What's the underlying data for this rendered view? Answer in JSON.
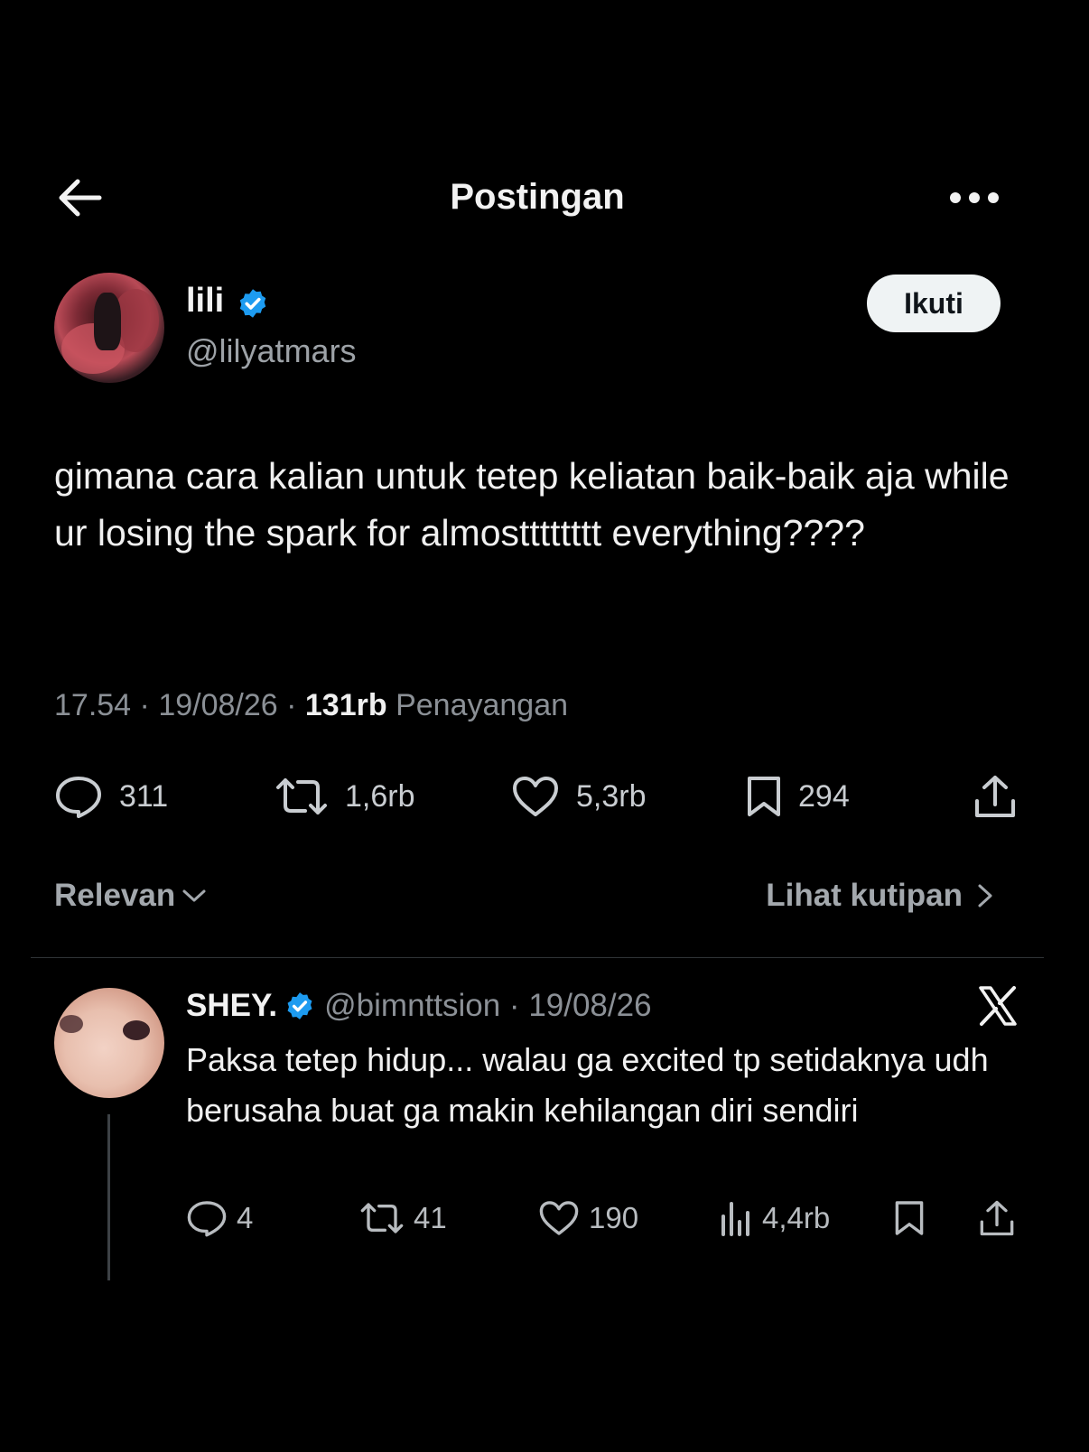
{
  "header": {
    "title": "Postingan",
    "back_icon": "arrow-left-icon",
    "more_icon": "more-dots-icon"
  },
  "post": {
    "author_name": "lili",
    "author_handle": "@lilyatmars",
    "follow_label": "Ikuti",
    "text": "gimana cara kalian untuk tetep keliatan baik-baik aja while ur losing the spark for almostttttttt everything????",
    "time": "17.54",
    "date": "19/08/26",
    "views_count": "131rb",
    "views_label": "Penayangan",
    "stats": {
      "replies": "311",
      "reposts": "1,6rb",
      "likes": "5,3rb",
      "bookmarks": "294"
    }
  },
  "sort": {
    "label": "Relevan",
    "quotes_label": "Lihat kutipan"
  },
  "reply": {
    "author_name": "SHEY.",
    "author_handle": "@bimnttsion",
    "date": "19/08/26",
    "text": "Paksa tetep hidup... walau ga excited tp setidaknya udh berusaha buat ga makin kehilangan diri sendiri",
    "stats": {
      "replies": "4",
      "reposts": "41",
      "likes": "190",
      "views": "4,4rb"
    }
  },
  "colors": {
    "background": "#000000",
    "verified": "#1d9bf0",
    "text": "#e7e9ea",
    "muted": "#8b9096"
  }
}
